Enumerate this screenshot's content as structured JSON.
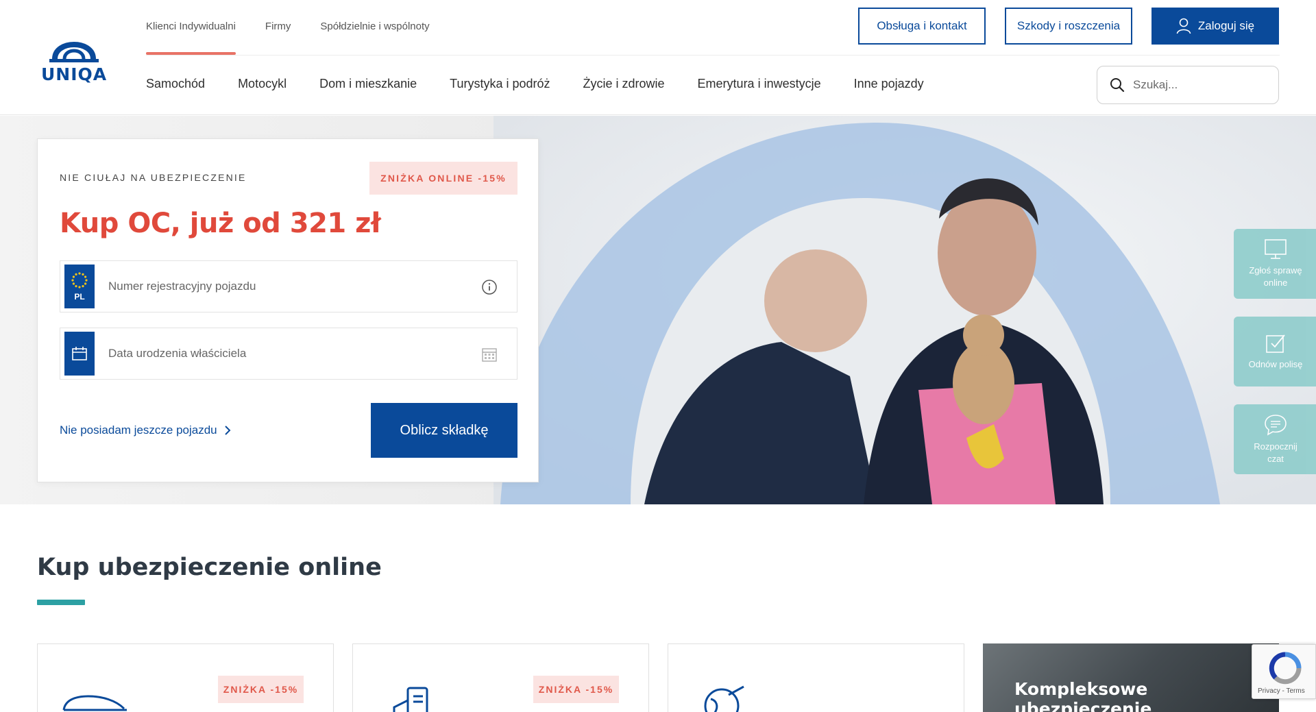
{
  "header": {
    "logo_text": "UNIQA",
    "segments": [
      "Klienci Indywidualni",
      "Firmy",
      "Spółdzielnie i wspólnoty"
    ],
    "top_buttons": {
      "contact": "Obsługa i kontakt",
      "claims": "Szkody i roszczenia",
      "login": "Zaloguj się"
    },
    "nav": [
      "Samochód",
      "Motocykl",
      "Dom i mieszkanie",
      "Turystyka i podróż",
      "Życie i zdrowie",
      "Emerytura i inwestycje",
      "Inne pojazdy"
    ],
    "search": {
      "placeholder": "Szukaj..."
    }
  },
  "hero": {
    "form": {
      "eyebrow": "NIE CIUŁAJ NA UBEZPIECZENIE",
      "discount": "ZNIŻKA ONLINE -15%",
      "headline": "Kup OC, już od 321 zł",
      "plate_tag": "PL",
      "plate_placeholder": "Numer rejestracyjny pojazdu",
      "birth_placeholder": "Data urodzenia właściciela",
      "no_vehicle_link": "Nie posiadam jeszcze pojazdu",
      "cta": "Oblicz składkę"
    }
  },
  "side_widgets": [
    {
      "label": "Zgłoś sprawę online",
      "icon": "monitor-icon"
    },
    {
      "label": "Odnów polisę",
      "icon": "edit-check-icon"
    },
    {
      "label": "Rozpocznij czat",
      "icon": "chat-icon"
    }
  ],
  "section": {
    "title": "Kup ubezpieczenie online",
    "cards": [
      {
        "badge": "ZNIŻKA -15%",
        "icon": "car-icon"
      },
      {
        "badge": "ZNIŻKA -15%",
        "icon": "house-document-icon"
      },
      {
        "badge": "",
        "icon": "globe-plane-icon"
      }
    ],
    "promo_title": "Kompleksowe ubezpieczenie"
  },
  "recaptcha": {
    "links": "Privacy - Terms"
  },
  "colors": {
    "brand_blue": "#0a4a9a",
    "accent_red": "#e0493b",
    "discount_bg": "#fbe3e1",
    "teal": "#2ca0a3",
    "widget_teal": "#8fcdcc"
  }
}
